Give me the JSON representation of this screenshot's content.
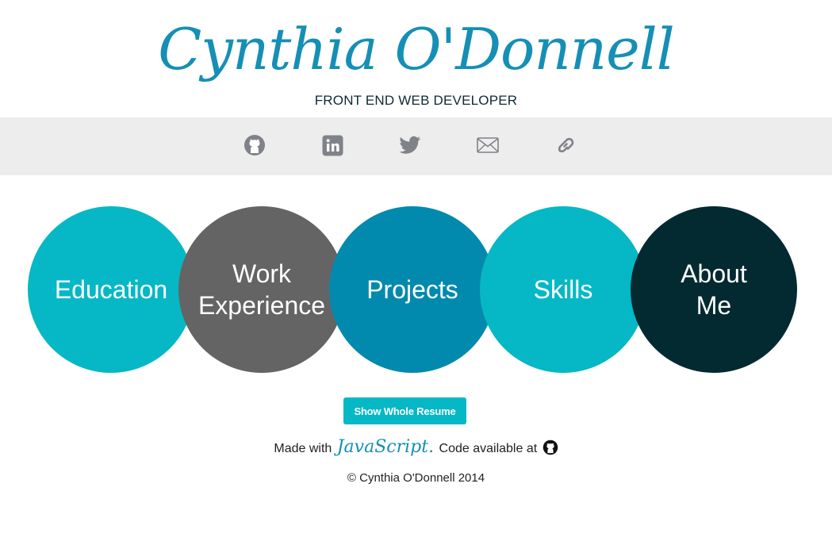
{
  "header": {
    "name": "Cynthia O'Donnell",
    "subtitle": "FRONT END WEB DEVELOPER"
  },
  "social": {
    "icons": [
      "github-icon",
      "linkedin-icon",
      "twitter-icon",
      "email-icon",
      "link-icon"
    ]
  },
  "sections": [
    {
      "label": "Education",
      "color": "#06b8c5"
    },
    {
      "label": "Work\nExperience",
      "color": "#646464"
    },
    {
      "label": "Projects",
      "color": "#028aae"
    },
    {
      "label": "Skills",
      "color": "#06b8c5"
    },
    {
      "label": "About\nMe",
      "color": "#022a30"
    }
  ],
  "resume_button": {
    "label": "Show Whole Resume"
  },
  "footer": {
    "made_with": "Made with",
    "js_logo": "JavaScript.",
    "code_available": "Code available at",
    "copyright": "© Cynthia O'Donnell 2014"
  },
  "colors": {
    "accent": "#158fb5",
    "icon_gray": "#7f8289",
    "bar_bg": "#ededed",
    "teal": "#06b8c5"
  }
}
